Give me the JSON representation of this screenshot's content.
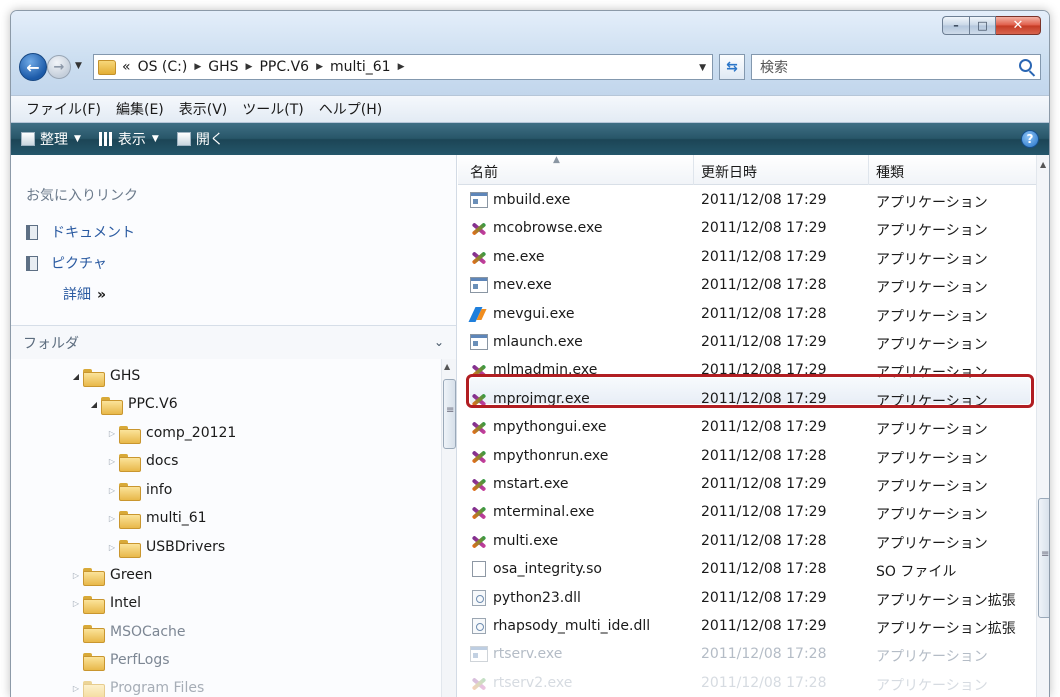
{
  "window": {
    "caption_buttons": {
      "minimize": "–",
      "maximize": "□",
      "close": "✕"
    }
  },
  "address": {
    "prefix": "«",
    "crumbs": [
      "OS (C:)",
      "GHS",
      "PPC.V6",
      "multi_61"
    ],
    "refresh_icon": "refresh-icon"
  },
  "search": {
    "placeholder": "検索"
  },
  "menu": [
    "ファイル(F)",
    "編集(E)",
    "表示(V)",
    "ツール(T)",
    "ヘルプ(H)"
  ],
  "commands": {
    "organize": "整理",
    "views": "表示",
    "open": "開く"
  },
  "navpane": {
    "favorites_title": "お気に入りリンク",
    "favorites": [
      "ドキュメント",
      "ピクチャ"
    ],
    "details_link": "詳細",
    "details_chevron": "»",
    "folders_title": "フォルダ",
    "tree": [
      {
        "label": "GHS",
        "state": "open"
      },
      {
        "label": "PPC.V6",
        "state": "open"
      },
      {
        "label": "comp_20121",
        "state": "closed"
      },
      {
        "label": "docs",
        "state": "closed"
      },
      {
        "label": "info",
        "state": "closed"
      },
      {
        "label": "multi_61",
        "state": "closed"
      },
      {
        "label": "USBDrivers",
        "state": "closed"
      },
      {
        "label": "Green",
        "state": "closed"
      },
      {
        "label": "Intel",
        "state": "closed"
      },
      {
        "label": "MSOCache",
        "state": "none"
      },
      {
        "label": "PerfLogs",
        "state": "none"
      },
      {
        "label": "Program Files",
        "state": "closed"
      }
    ]
  },
  "filelist": {
    "columns": {
      "name": "名前",
      "date": "更新日時",
      "type": "種類"
    },
    "files": [
      {
        "name": "mbuild.exe",
        "date": "2011/12/08 17:29",
        "type": "アプリケーション",
        "icon": "app"
      },
      {
        "name": "mcobrowse.exe",
        "date": "2011/12/08 17:29",
        "type": "アプリケーション",
        "icon": "x"
      },
      {
        "name": "me.exe",
        "date": "2011/12/08 17:29",
        "type": "アプリケーション",
        "icon": "x"
      },
      {
        "name": "mev.exe",
        "date": "2011/12/08 17:28",
        "type": "アプリケーション",
        "icon": "app"
      },
      {
        "name": "mevgui.exe",
        "date": "2011/12/08 17:28",
        "type": "アプリケーション",
        "icon": "wave"
      },
      {
        "name": "mlaunch.exe",
        "date": "2011/12/08 17:29",
        "type": "アプリケーション",
        "icon": "app"
      },
      {
        "name": "mlmadmin.exe",
        "date": "2011/12/08 17:29",
        "type": "アプリケーション",
        "icon": "x"
      },
      {
        "name": "mprojmgr.exe",
        "date": "2011/12/08 17:29",
        "type": "アプリケーション",
        "icon": "x"
      },
      {
        "name": "mpythongui.exe",
        "date": "2011/12/08 17:29",
        "type": "アプリケーション",
        "icon": "x"
      },
      {
        "name": "mpythonrun.exe",
        "date": "2011/12/08 17:28",
        "type": "アプリケーション",
        "icon": "x"
      },
      {
        "name": "mstart.exe",
        "date": "2011/12/08 17:29",
        "type": "アプリケーション",
        "icon": "x"
      },
      {
        "name": "mterminal.exe",
        "date": "2011/12/08 17:29",
        "type": "アプリケーション",
        "icon": "x"
      },
      {
        "name": "multi.exe",
        "date": "2011/12/08 17:28",
        "type": "アプリケーション",
        "icon": "x"
      },
      {
        "name": "osa_integrity.so",
        "date": "2011/12/08 17:28",
        "type": "SO ファイル",
        "icon": "doc"
      },
      {
        "name": "python23.dll",
        "date": "2011/12/08 17:29",
        "type": "アプリケーション拡張",
        "icon": "dll"
      },
      {
        "name": "rhapsody_multi_ide.dll",
        "date": "2011/12/08 17:29",
        "type": "アプリケーション拡張",
        "icon": "dll"
      },
      {
        "name": "rtserv.exe",
        "date": "2011/12/08 17:28",
        "type": "アプリケーション",
        "icon": "app"
      },
      {
        "name": "rtserv2.exe",
        "date": "2011/12/08 17:28",
        "type": "アプリケーション",
        "icon": "x"
      }
    ]
  },
  "highlight": {
    "file": "mlmadmin.exe",
    "color": "#b11e22"
  }
}
